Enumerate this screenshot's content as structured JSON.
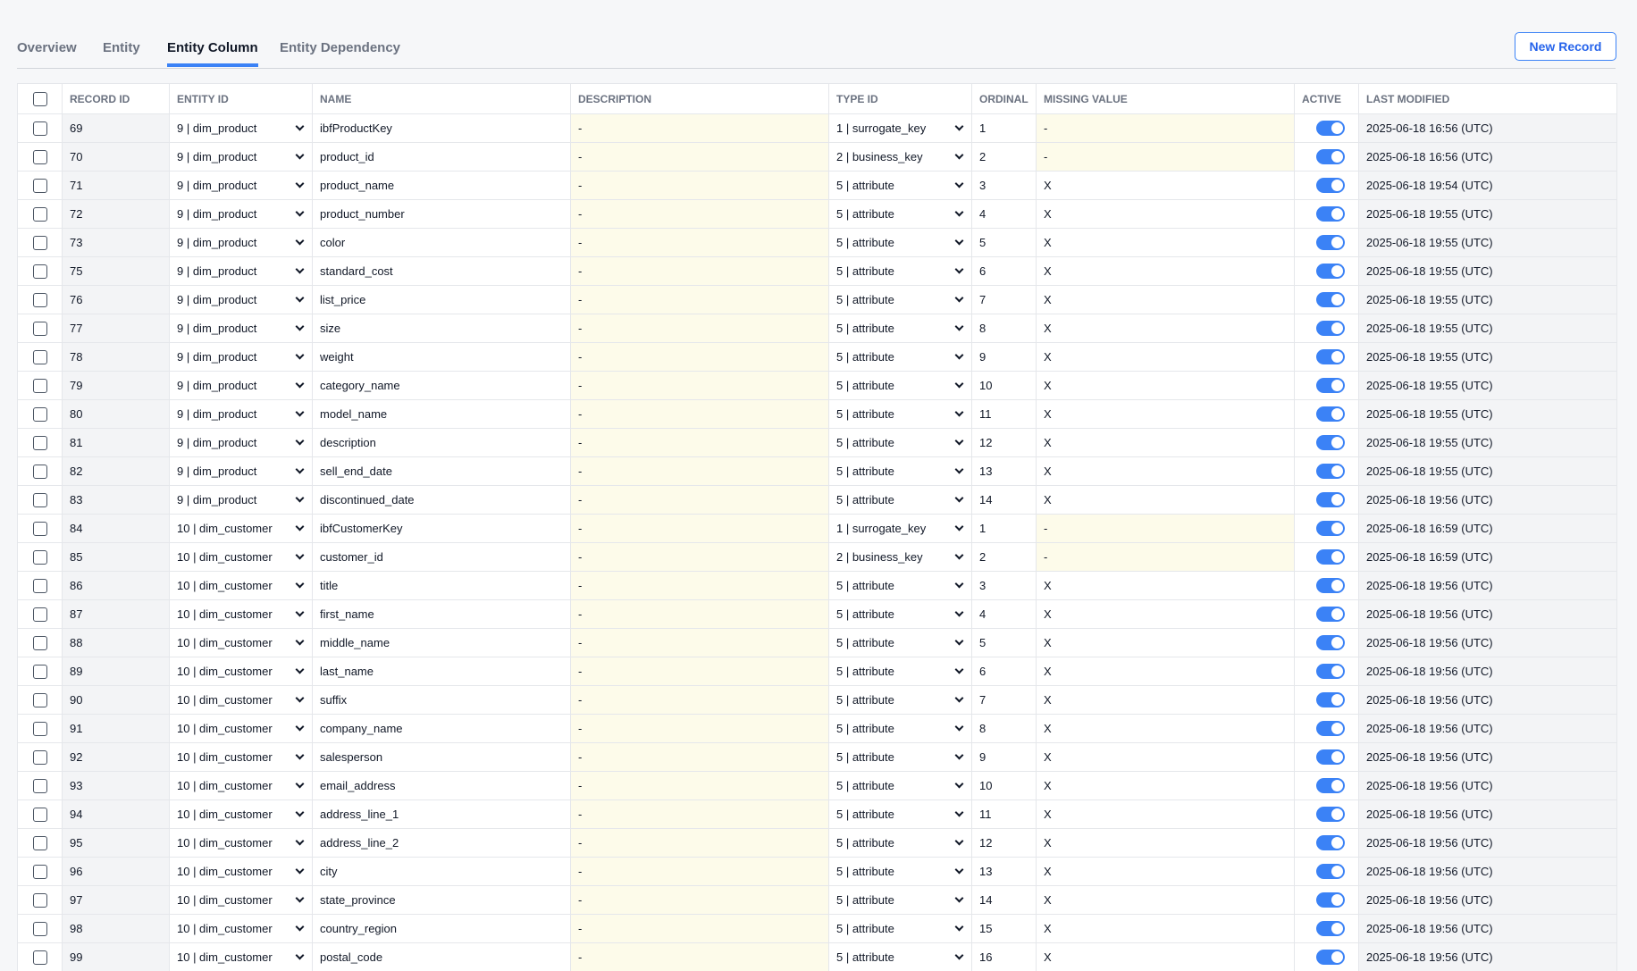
{
  "tabs": [
    {
      "label": "Overview",
      "active": false
    },
    {
      "label": "Entity",
      "active": false
    },
    {
      "label": "Entity Column",
      "active": true
    },
    {
      "label": "Entity Dependency",
      "active": false
    }
  ],
  "new_record_label": "New Record",
  "columns": [
    "RECORD ID",
    "ENTITY ID",
    "NAME",
    "DESCRIPTION",
    "TYPE ID",
    "ORDINAL",
    "MISSING VALUE",
    "ACTIVE",
    "LAST MODIFIED"
  ],
  "rows": [
    {
      "id": "69",
      "entity": "9 | dim_product",
      "name": "ibfProductKey",
      "desc": "-",
      "type": "1 | surrogate_key",
      "ordinal": "1",
      "missing": "-",
      "active": true,
      "modified": "2025-06-18 16:56 (UTC)"
    },
    {
      "id": "70",
      "entity": "9 | dim_product",
      "name": "product_id",
      "desc": "-",
      "type": "2 | business_key",
      "ordinal": "2",
      "missing": "-",
      "active": true,
      "modified": "2025-06-18 16:56 (UTC)"
    },
    {
      "id": "71",
      "entity": "9 | dim_product",
      "name": "product_name",
      "desc": "-",
      "type": "5 | attribute",
      "ordinal": "3",
      "missing": "X",
      "active": true,
      "modified": "2025-06-18 19:54 (UTC)"
    },
    {
      "id": "72",
      "entity": "9 | dim_product",
      "name": "product_number",
      "desc": "-",
      "type": "5 | attribute",
      "ordinal": "4",
      "missing": "X",
      "active": true,
      "modified": "2025-06-18 19:55 (UTC)"
    },
    {
      "id": "73",
      "entity": "9 | dim_product",
      "name": "color",
      "desc": "-",
      "type": "5 | attribute",
      "ordinal": "5",
      "missing": "X",
      "active": true,
      "modified": "2025-06-18 19:55 (UTC)"
    },
    {
      "id": "75",
      "entity": "9 | dim_product",
      "name": "standard_cost",
      "desc": "-",
      "type": "5 | attribute",
      "ordinal": "6",
      "missing": "X",
      "active": true,
      "modified": "2025-06-18 19:55 (UTC)"
    },
    {
      "id": "76",
      "entity": "9 | dim_product",
      "name": "list_price",
      "desc": "-",
      "type": "5 | attribute",
      "ordinal": "7",
      "missing": "X",
      "active": true,
      "modified": "2025-06-18 19:55 (UTC)"
    },
    {
      "id": "77",
      "entity": "9 | dim_product",
      "name": "size",
      "desc": "-",
      "type": "5 | attribute",
      "ordinal": "8",
      "missing": "X",
      "active": true,
      "modified": "2025-06-18 19:55 (UTC)"
    },
    {
      "id": "78",
      "entity": "9 | dim_product",
      "name": "weight",
      "desc": "-",
      "type": "5 | attribute",
      "ordinal": "9",
      "missing": "X",
      "active": true,
      "modified": "2025-06-18 19:55 (UTC)"
    },
    {
      "id": "79",
      "entity": "9 | dim_product",
      "name": "category_name",
      "desc": "-",
      "type": "5 | attribute",
      "ordinal": "10",
      "missing": "X",
      "active": true,
      "modified": "2025-06-18 19:55 (UTC)"
    },
    {
      "id": "80",
      "entity": "9 | dim_product",
      "name": "model_name",
      "desc": "-",
      "type": "5 | attribute",
      "ordinal": "11",
      "missing": "X",
      "active": true,
      "modified": "2025-06-18 19:55 (UTC)"
    },
    {
      "id": "81",
      "entity": "9 | dim_product",
      "name": "description",
      "desc": "-",
      "type": "5 | attribute",
      "ordinal": "12",
      "missing": "X",
      "active": true,
      "modified": "2025-06-18 19:55 (UTC)"
    },
    {
      "id": "82",
      "entity": "9 | dim_product",
      "name": "sell_end_date",
      "desc": "-",
      "type": "5 | attribute",
      "ordinal": "13",
      "missing": "X",
      "active": true,
      "modified": "2025-06-18 19:55 (UTC)"
    },
    {
      "id": "83",
      "entity": "9 | dim_product",
      "name": "discontinued_date",
      "desc": "-",
      "type": "5 | attribute",
      "ordinal": "14",
      "missing": "X",
      "active": true,
      "modified": "2025-06-18 19:56 (UTC)"
    },
    {
      "id": "84",
      "entity": "10 | dim_customer",
      "name": "ibfCustomerKey",
      "desc": "-",
      "type": "1 | surrogate_key",
      "ordinal": "1",
      "missing": "-",
      "active": true,
      "modified": "2025-06-18 16:59 (UTC)"
    },
    {
      "id": "85",
      "entity": "10 | dim_customer",
      "name": "customer_id",
      "desc": "-",
      "type": "2 | business_key",
      "ordinal": "2",
      "missing": "-",
      "active": true,
      "modified": "2025-06-18 16:59 (UTC)"
    },
    {
      "id": "86",
      "entity": "10 | dim_customer",
      "name": "title",
      "desc": "-",
      "type": "5 | attribute",
      "ordinal": "3",
      "missing": "X",
      "active": true,
      "modified": "2025-06-18 19:56 (UTC)"
    },
    {
      "id": "87",
      "entity": "10 | dim_customer",
      "name": "first_name",
      "desc": "-",
      "type": "5 | attribute",
      "ordinal": "4",
      "missing": "X",
      "active": true,
      "modified": "2025-06-18 19:56 (UTC)"
    },
    {
      "id": "88",
      "entity": "10 | dim_customer",
      "name": "middle_name",
      "desc": "-",
      "type": "5 | attribute",
      "ordinal": "5",
      "missing": "X",
      "active": true,
      "modified": "2025-06-18 19:56 (UTC)"
    },
    {
      "id": "89",
      "entity": "10 | dim_customer",
      "name": "last_name",
      "desc": "-",
      "type": "5 | attribute",
      "ordinal": "6",
      "missing": "X",
      "active": true,
      "modified": "2025-06-18 19:56 (UTC)"
    },
    {
      "id": "90",
      "entity": "10 | dim_customer",
      "name": "suffix",
      "desc": "-",
      "type": "5 | attribute",
      "ordinal": "7",
      "missing": "X",
      "active": true,
      "modified": "2025-06-18 19:56 (UTC)"
    },
    {
      "id": "91",
      "entity": "10 | dim_customer",
      "name": "company_name",
      "desc": "-",
      "type": "5 | attribute",
      "ordinal": "8",
      "missing": "X",
      "active": true,
      "modified": "2025-06-18 19:56 (UTC)"
    },
    {
      "id": "92",
      "entity": "10 | dim_customer",
      "name": "salesperson",
      "desc": "-",
      "type": "5 | attribute",
      "ordinal": "9",
      "missing": "X",
      "active": true,
      "modified": "2025-06-18 19:56 (UTC)"
    },
    {
      "id": "93",
      "entity": "10 | dim_customer",
      "name": "email_address",
      "desc": "-",
      "type": "5 | attribute",
      "ordinal": "10",
      "missing": "X",
      "active": true,
      "modified": "2025-06-18 19:56 (UTC)"
    },
    {
      "id": "94",
      "entity": "10 | dim_customer",
      "name": "address_line_1",
      "desc": "-",
      "type": "5 | attribute",
      "ordinal": "11",
      "missing": "X",
      "active": true,
      "modified": "2025-06-18 19:56 (UTC)"
    },
    {
      "id": "95",
      "entity": "10 | dim_customer",
      "name": "address_line_2",
      "desc": "-",
      "type": "5 | attribute",
      "ordinal": "12",
      "missing": "X",
      "active": true,
      "modified": "2025-06-18 19:56 (UTC)"
    },
    {
      "id": "96",
      "entity": "10 | dim_customer",
      "name": "city",
      "desc": "-",
      "type": "5 | attribute",
      "ordinal": "13",
      "missing": "X",
      "active": true,
      "modified": "2025-06-18 19:56 (UTC)"
    },
    {
      "id": "97",
      "entity": "10 | dim_customer",
      "name": "state_province",
      "desc": "-",
      "type": "5 | attribute",
      "ordinal": "14",
      "missing": "X",
      "active": true,
      "modified": "2025-06-18 19:56 (UTC)"
    },
    {
      "id": "98",
      "entity": "10 | dim_customer",
      "name": "country_region",
      "desc": "-",
      "type": "5 | attribute",
      "ordinal": "15",
      "missing": "X",
      "active": true,
      "modified": "2025-06-18 19:56 (UTC)"
    },
    {
      "id": "99",
      "entity": "10 | dim_customer",
      "name": "postal_code",
      "desc": "-",
      "type": "5 | attribute",
      "ordinal": "16",
      "missing": "X",
      "active": true,
      "modified": "2025-06-18 19:56 (UTC)"
    }
  ]
}
